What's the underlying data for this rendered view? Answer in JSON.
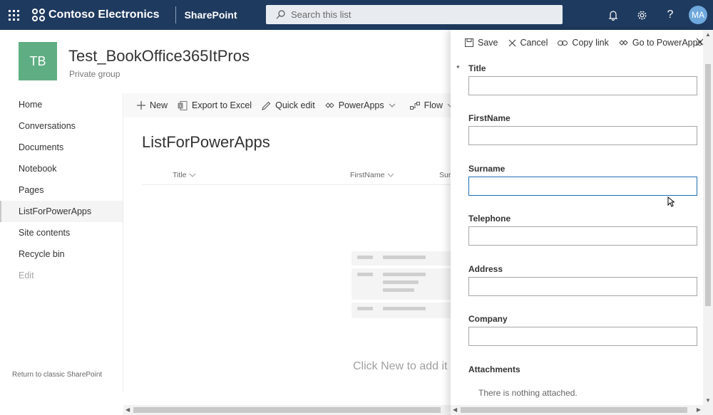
{
  "suitebar": {
    "org_name": "Contoso Electronics",
    "app_name": "SharePoint",
    "search_placeholder": "Search this list",
    "avatar_initials": "MA",
    "brand_color": "#1f3a5f"
  },
  "site": {
    "logo_initials": "TB",
    "logo_color": "#5fae83",
    "title": "Test_BookOffice365ItPros",
    "subtitle": "Private group"
  },
  "nav": {
    "items": [
      {
        "label": "Home"
      },
      {
        "label": "Conversations"
      },
      {
        "label": "Documents"
      },
      {
        "label": "Notebook"
      },
      {
        "label": "Pages"
      },
      {
        "label": "ListForPowerApps"
      },
      {
        "label": "Site contents"
      },
      {
        "label": "Recycle bin"
      },
      {
        "label": "Edit"
      }
    ],
    "classic_link": "Return to classic SharePoint"
  },
  "commandbar": {
    "new": "New",
    "export": "Export to Excel",
    "quick_edit": "Quick edit",
    "powerapps": "PowerApps",
    "flow": "Flow"
  },
  "list": {
    "title": "ListForPowerApps",
    "columns": [
      "Title",
      "FirstName",
      "Surn"
    ],
    "empty_text": "Click New to add it"
  },
  "panel": {
    "save": "Save",
    "cancel": "Cancel",
    "copy_link": "Copy link",
    "go_powerapps": "Go to PowerApps",
    "required_marker": "*",
    "fields": [
      {
        "label": "Title",
        "value": ""
      },
      {
        "label": "FirstName",
        "value": ""
      },
      {
        "label": "Surname",
        "value": ""
      },
      {
        "label": "Telephone",
        "value": ""
      },
      {
        "label": "Address",
        "value": ""
      },
      {
        "label": "Company",
        "value": ""
      }
    ],
    "attachments_label": "Attachments",
    "attachments_empty": "There is nothing attached."
  }
}
